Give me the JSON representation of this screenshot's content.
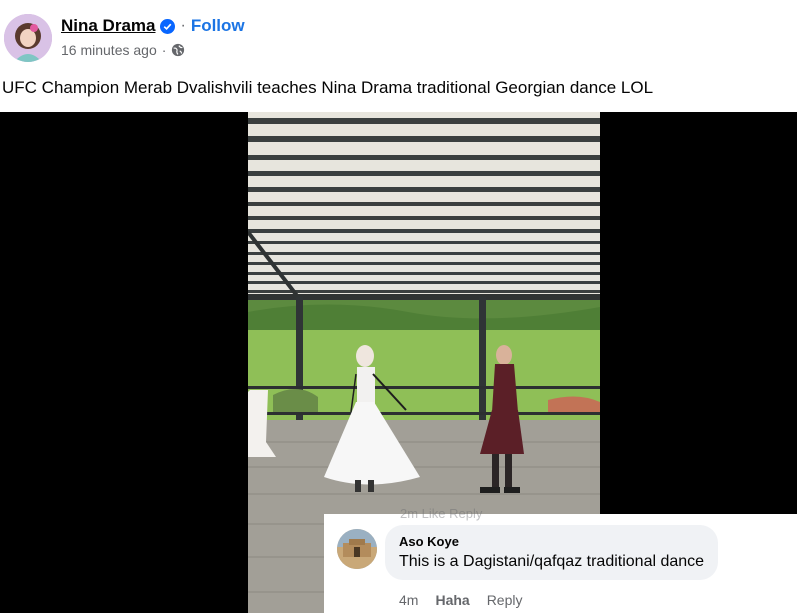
{
  "post": {
    "author": "Nina Drama",
    "follow_label": "Follow",
    "separator": "·",
    "timestamp": "16 minutes ago",
    "meta_separator": "·",
    "caption": "UFC Champion Merab Dvalishvili teaches Nina Drama traditional Georgian dance LOL"
  },
  "comment": {
    "faded_actions": "2m   Like   Reply",
    "author": "Aso Koye",
    "text": "This is a Dagistani/qafqaz traditional dance",
    "time": "4m",
    "reaction_label": "Haha",
    "reply_label": "Reply"
  },
  "icons": {
    "verified": "verified-badge-icon",
    "privacy": "globe-icon"
  },
  "colors": {
    "link_blue": "#1b74e4",
    "verified_blue": "#0866ff",
    "secondary_text": "#65676b",
    "bubble_bg": "#f0f2f5"
  }
}
